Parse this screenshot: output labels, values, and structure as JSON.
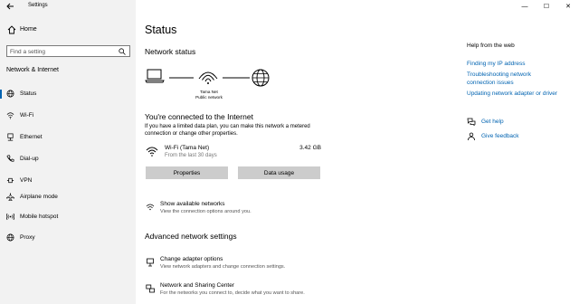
{
  "window": {
    "app_title": "Settings",
    "controls": {
      "minimize": "—",
      "maximize": "☐",
      "close": "✕"
    }
  },
  "sidebar": {
    "home_label": "Home",
    "search_placeholder": "Find a setting",
    "section_title": "Network & Internet",
    "items": [
      {
        "label": "Status",
        "icon": "globe-icon",
        "active": true
      },
      {
        "label": "Wi-Fi",
        "icon": "wifi-icon"
      },
      {
        "label": "Ethernet",
        "icon": "ethernet-icon"
      },
      {
        "label": "Dial-up",
        "icon": "phone-icon"
      },
      {
        "label": "VPN",
        "icon": "vpn-icon"
      },
      {
        "label": "Airplane mode",
        "icon": "airplane-icon"
      },
      {
        "label": "Mobile hotspot",
        "icon": "hotspot-icon"
      },
      {
        "label": "Proxy",
        "icon": "globe-icon"
      }
    ]
  },
  "main": {
    "title": "Status",
    "network_status_heading": "Network status",
    "network_name": "Tama Net",
    "network_type": "Public network",
    "connected_heading": "You're connected to the Internet",
    "connected_desc": "If you have a limited data plan, you can make this network a metered connection or change other properties.",
    "wifi": {
      "name": "Wi-Fi (Tama Net)",
      "sub": "From the last 30 days",
      "size": "3.42 GB"
    },
    "buttons": {
      "properties": "Properties",
      "data_usage": "Data usage"
    },
    "show_networks": {
      "title": "Show available networks",
      "desc": "View the connection options around you."
    },
    "advanced_heading": "Advanced network settings",
    "change_adapter": {
      "title": "Change adapter options",
      "desc": "View network adapters and change connection settings."
    },
    "sharing_center": {
      "title": "Network and Sharing Center",
      "desc": "For the networks you connect to, decide what you want to share."
    }
  },
  "help": {
    "title": "Help from the web",
    "links": [
      "Finding my IP address",
      "Troubleshooting network connection issues",
      "Updating network adapter or driver"
    ],
    "get_help": "Get help",
    "give_feedback": "Give feedback"
  },
  "colors": {
    "accent": "#0063b1",
    "sidebar_bg": "#f2f2f2",
    "button_bg": "#cccccc"
  }
}
